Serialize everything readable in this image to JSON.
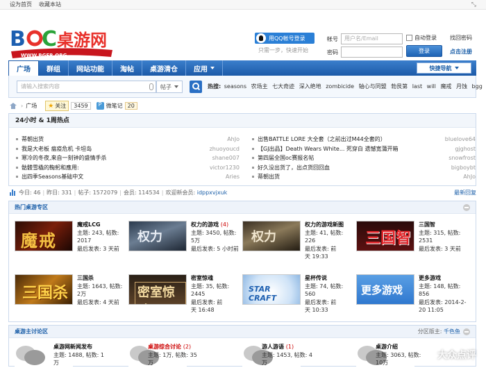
{
  "topbar": {
    "set_home": "设为首页",
    "bookmark": "收藏本站"
  },
  "logo": {
    "text": "BGC桌游网",
    "url": "WWW.BGER.ORG"
  },
  "login": {
    "qq_button": "用QQ帐号登录",
    "one_step": "只需一步，快速开始",
    "account_label": "帐号",
    "account_placeholder": "用户名/Email",
    "password_label": "密码",
    "auto_login": "自动登录",
    "find_password": "找回密码",
    "login_button": "登录",
    "register": "点击注册"
  },
  "nav": {
    "items": [
      "广场",
      "群组",
      "网站功能",
      "淘帖",
      "桌游清仓",
      "应用"
    ],
    "quick_nav": "快捷导航"
  },
  "search": {
    "placeholder": "请输入搜索内容",
    "type": "帖子",
    "hot_label": "热搜:",
    "hot_words": [
      "seasons",
      "农场主",
      "七大奇迹",
      "深入绝地",
      "zombicide",
      "轴心与同盟",
      "勃艮第",
      "last",
      "will",
      "魔戒",
      "月蚀",
      "bgg"
    ]
  },
  "crumbs": {
    "location": "广场",
    "follow": "关注",
    "follow_count": "3459",
    "note": "微笔记",
    "note_count": "20"
  },
  "hot": {
    "title": "24小时 & 1周热点",
    "left": [
      {
        "title": "蒂朝出货",
        "user": "AhJo"
      },
      {
        "title": "我是大老板 瘟疫危机 卡坦岛",
        "user": "zhuoyoucd"
      },
      {
        "title": "寒冷的冬夜,来自一刻钟的盛情手杀",
        "user": "shane007"
      },
      {
        "title": "骷髅雪橇的鞠躬和應用:",
        "user": "victor1230"
      },
      {
        "title": "出四季Seasons基础中文",
        "user": "Aries"
      }
    ],
    "right": [
      {
        "title": "出售BATTLE LORE 大全套（之前出过M44全套的）",
        "user": "bluelove64"
      },
      {
        "title": "【GJ出品】Death Wears White... 死穿白 遗憾宽蒲开箱",
        "user": "gjghost"
      },
      {
        "title": "第四届全国oc赛报名帖",
        "user": "snowfrost"
      },
      {
        "title": "好久没出货了，出点货回回血",
        "user": "bigboybt"
      },
      {
        "title": "蒂朝出货",
        "user": "AhJo"
      }
    ]
  },
  "stats": {
    "today_label": "今日:",
    "today": "46",
    "yesterday_label": "昨日:",
    "yesterday": "331",
    "posts_label": "帖子:",
    "posts": "1572079",
    "members_label": "会员:",
    "members": "114534",
    "welcome_label": "欢迎新会员:",
    "new_member": "idppxvjxuk",
    "latest": "最新回复"
  },
  "zone1": {
    "title": "热门桌游专区",
    "forums": [
      {
        "thumb": "魔戒",
        "name": "魔戒LCG",
        "hot": "",
        "l1": "主题: 243, 帖数:",
        "l2": "2017",
        "l3": "最后发表: 3 天前",
        "l4": ""
      },
      {
        "thumb": "权力",
        "name": "权力的游戏",
        "hot": "(4)",
        "l1": "主题: 3450, 帖数:",
        "l2": "5万",
        "l3": "最后发表: 5 小时前",
        "l4": ""
      },
      {
        "thumb": "权力",
        "name": "权力的游戏新图",
        "hot": "",
        "l1": "主题: 41, 帖数:",
        "l2": "226",
        "l3": "最后发表: 前",
        "l4": "天 19:33"
      },
      {
        "thumb": "三国智",
        "name": "三国智",
        "hot": "",
        "l1": "主题: 315, 帖数:",
        "l2": "2531",
        "l3": "最后发表: 3 天前",
        "l4": ""
      },
      {
        "thumb": "三国杀",
        "name": "三国杀",
        "hot": "",
        "l1": "主题: 1643, 帖数:",
        "l2": "2万",
        "l3": "最后发表: 4 天前",
        "l4": ""
      },
      {
        "thumb": "密室惊魂",
        "name": "密室惊魂",
        "hot": "",
        "l1": "主题: 35, 帖数:",
        "l2": "2445",
        "l3": "最后发表: 前",
        "l4": "天 16:48"
      },
      {
        "thumb": "STAR CRAFT",
        "name": "星杯传说",
        "hot": "",
        "l1": "主题: 74, 帖数:",
        "l2": "560",
        "l3": "最后发表: 前",
        "l4": "天 10:33"
      },
      {
        "thumb": "更多游戏",
        "name": "更多游戏",
        "hot": "",
        "l1": "主题: 148, 帖数:",
        "l2": "856",
        "l3": "最后发表: 2014-2-",
        "l4": "20 11:05"
      }
    ]
  },
  "zone2": {
    "title": "桌游主讨论区",
    "mods_label": "分区版主:",
    "mods": "千色鱼",
    "forums": [
      {
        "name": "桌游网新闻发布",
        "hot": "",
        "l1": "主题: 1488, 帖数: 1万"
      },
      {
        "name": "桌游综合讨论",
        "hot": "(2)",
        "l1": "主题: 1万, 帖数: 35万"
      },
      {
        "name": "游人游语",
        "hot": "(1)",
        "l1": "主题: 1453, 帖数: 4万"
      },
      {
        "name": "桌游介绍",
        "hot": "",
        "l1": "主题: 3063, 帖数: 10万"
      }
    ]
  },
  "watermark": "大众点评"
}
